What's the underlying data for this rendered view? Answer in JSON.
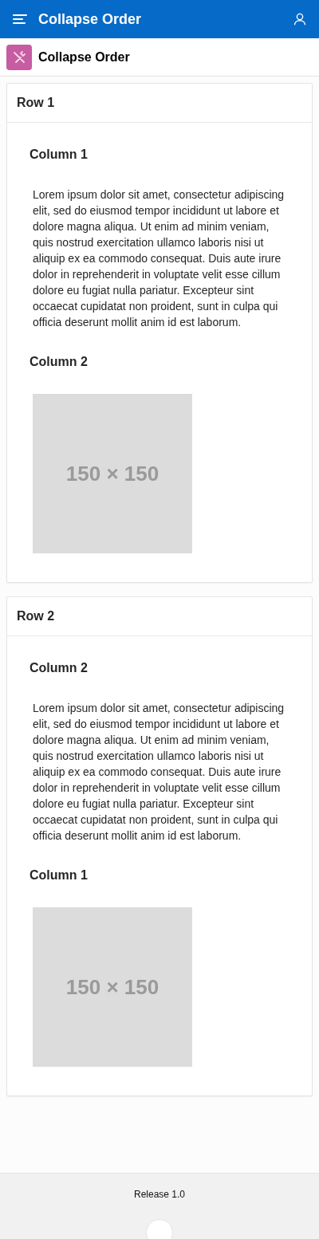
{
  "header": {
    "title": "Collapse Order"
  },
  "page": {
    "title": "Collapse Order"
  },
  "rows": [
    {
      "title": "Row 1",
      "columns": [
        {
          "title": "Column 1",
          "kind": "text",
          "text": "Lorem ipsum dolor sit amet, consectetur adipiscing elit, sed do eiusmod tempor incididunt ut labore et dolore magna aliqua. Ut enim ad minim veniam, quis nostrud exercitation ullamco laboris nisi ut aliquip ex ea commodo consequat. Duis aute irure dolor in reprehenderit in voluptate velit esse cillum dolore eu fugiat nulla pariatur. Excepteur sint occaecat cupidatat non proident, sunt in culpa qui officia deserunt mollit anim id est laborum."
        },
        {
          "title": "Column 2",
          "kind": "image",
          "text": "150 × 150"
        }
      ]
    },
    {
      "title": "Row 2",
      "columns": [
        {
          "title": "Column 2",
          "kind": "text",
          "text": "Lorem ipsum dolor sit amet, consectetur adipiscing elit, sed do eiusmod tempor incididunt ut labore et dolore magna aliqua. Ut enim ad minim veniam, quis nostrud exercitation ullamco laboris nisi ut aliquip ex ea commodo consequat. Duis aute irure dolor in reprehenderit in voluptate velit esse cillum dolore eu fugiat nulla pariatur. Excepteur sint occaecat cupidatat non proident, sunt in culpa qui officia deserunt mollit anim id est laborum."
        },
        {
          "title": "Column 1",
          "kind": "image",
          "text": "150 × 150"
        }
      ]
    }
  ],
  "footer": {
    "release": "Release 1.0"
  }
}
